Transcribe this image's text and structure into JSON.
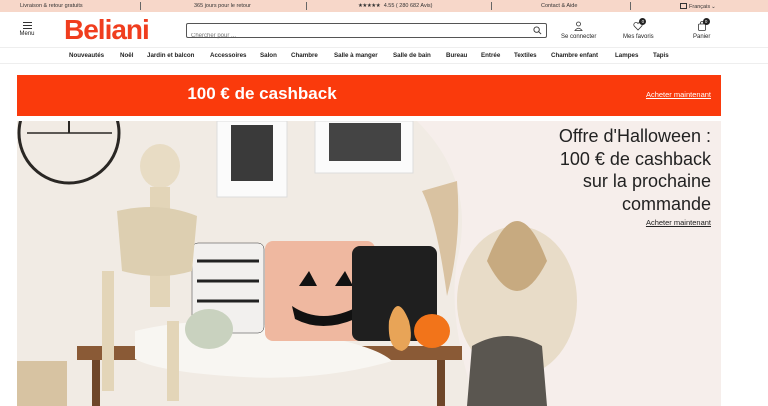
{
  "topbar": {
    "delivery": "Livraison & retour gratuits",
    "returns": "365 jours pour le retour",
    "stars": "★★★★★",
    "rating": "4.55 ( 280 682 Avis)",
    "contact": "Contact & Aide",
    "language": "Français"
  },
  "header": {
    "menu_label": "Menu",
    "logo": "Beliani",
    "search_placeholder": "Chercher pour ...",
    "login_label": "Se connecter",
    "favorites_label": "Mes favoris",
    "favorites_count": "0",
    "cart_label": "Panier",
    "cart_count": "0"
  },
  "nav": {
    "items": [
      "Nouveautés",
      "Noël",
      "Jardin et balcon",
      "Accessoires",
      "Salon",
      "Chambre",
      "Salle à manger",
      "Salle de bain",
      "Bureau",
      "Entrée",
      "Textiles",
      "Chambre enfant",
      "Lampes",
      "Tapis"
    ]
  },
  "banner": {
    "title": "100 € de cashback",
    "link": "Acheter maintenant"
  },
  "hero": {
    "offer_lines": [
      "Offre d'Halloween :",
      "100 € de cashback",
      "sur la prochaine",
      "commande"
    ],
    "link": "Acheter maintenant"
  },
  "colors": {
    "brand": "#f03d1e",
    "banner": "#fa3a0c",
    "topbar": "#f7d7c9"
  }
}
